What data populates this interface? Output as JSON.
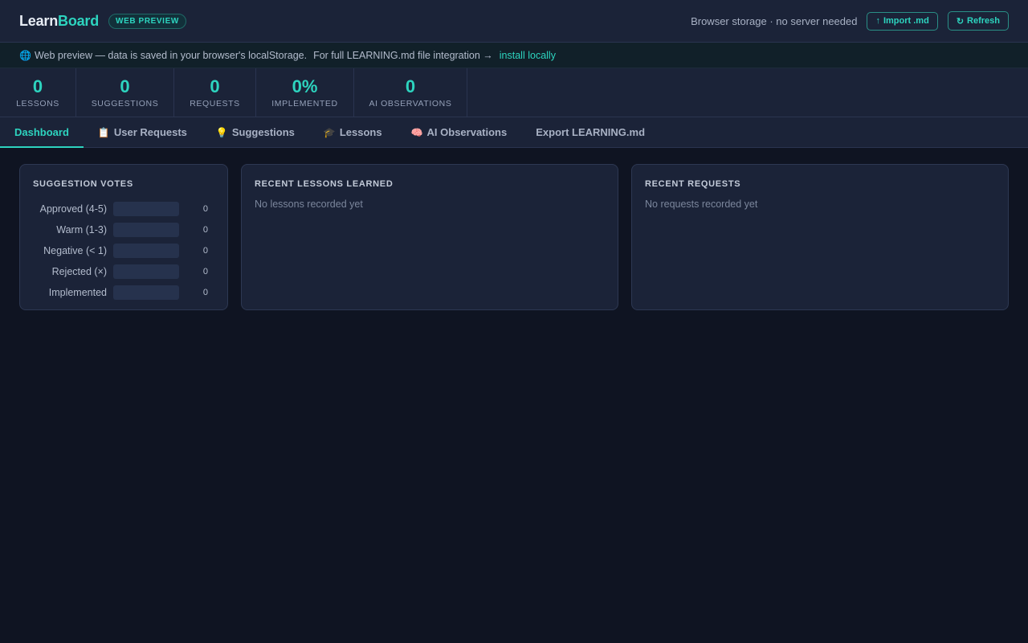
{
  "header": {
    "logo_part1": "Learn",
    "logo_part2": "Board",
    "badge": "WEB PREVIEW",
    "storage_note": "Browser storage · no server needed",
    "import_icon": "↑",
    "import_label": "Import .md",
    "refresh_icon": "↻",
    "refresh_label": "Refresh"
  },
  "banner": {
    "icon": "🌐",
    "text1": "Web preview — data is saved in your browser's localStorage.",
    "text2": "For full LEARNING.md file integration →",
    "link": "install locally"
  },
  "stats": [
    {
      "value": "0",
      "label": "LESSONS"
    },
    {
      "value": "0",
      "label": "SUGGESTIONS"
    },
    {
      "value": "0",
      "label": "REQUESTS"
    },
    {
      "value": "0%",
      "label": "IMPLEMENTED"
    },
    {
      "value": "0",
      "label": "AI OBSERVATIONS"
    }
  ],
  "tabs": [
    {
      "icon": "",
      "label": "Dashboard"
    },
    {
      "icon": "📋",
      "label": "User Requests"
    },
    {
      "icon": "💡",
      "label": "Suggestions"
    },
    {
      "icon": "🎓",
      "label": "Lessons"
    },
    {
      "icon": "🧠",
      "label": "AI Observations"
    },
    {
      "icon": "",
      "label": "Export LEARNING.md"
    }
  ],
  "active_tab": "Dashboard",
  "votes": {
    "title": "SUGGESTION VOTES",
    "rows": [
      {
        "label": "Approved (4-5)",
        "count": "0",
        "fraction": 0
      },
      {
        "label": "Warm (1-3)",
        "count": "0",
        "fraction": 0
      },
      {
        "label": "Negative (< 1)",
        "count": "0",
        "fraction": 0
      },
      {
        "label": "Rejected (×)",
        "count": "0",
        "fraction": 0
      },
      {
        "label": "Implemented",
        "count": "0",
        "fraction": 0
      }
    ]
  },
  "lessons": {
    "title": "RECENT LESSONS LEARNED",
    "empty": "No lessons recorded yet"
  },
  "requests": {
    "title": "RECENT REQUESTS",
    "empty": "No requests recorded yet"
  },
  "colors": {
    "accent": "#2dd4bf",
    "background": "#0f1422",
    "panel": "#1b2338"
  }
}
